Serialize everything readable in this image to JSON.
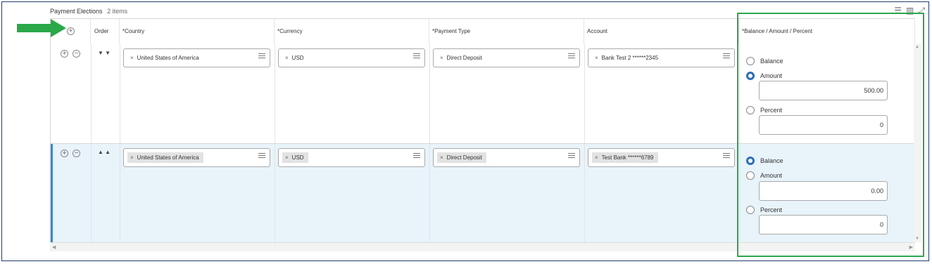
{
  "section": {
    "title": "Payment Elections",
    "count": "2 items"
  },
  "columns": {
    "order": "Order",
    "country": "*Country",
    "currency": "*Currency",
    "payment_type": "*Payment Type",
    "account": "Account",
    "balance": "*Balance / Amount / Percent"
  },
  "rows": [
    {
      "order_arrows": "▼ ▼",
      "country": "United States of America",
      "currency": "USD",
      "payment_type": "Direct Deposit",
      "account": "Bank Test 2 ******2345",
      "options": {
        "balance": "Balance",
        "amount": "Amount",
        "percent": "Percent"
      },
      "selected": "amount",
      "amount_value": "500.00",
      "percent_value": "0"
    },
    {
      "order_arrows": "▲ ▲",
      "country": "United States of America",
      "currency": "USD",
      "payment_type": "Direct Deposit",
      "account": "Test Bank ******6789",
      "options": {
        "balance": "Balance",
        "amount": "Amount",
        "percent": "Percent"
      },
      "selected": "balance",
      "amount_value": "0.00",
      "percent_value": "0"
    }
  ],
  "icons": {
    "add": "plus-circle-icon",
    "remove": "minus-circle-icon",
    "remove_chip": "x-icon",
    "prompt": "list-icon",
    "filter": "filter-icon",
    "columns": "columns-icon",
    "expand": "expand-icon"
  },
  "colors": {
    "highlight": "#2aa84a",
    "arrow": "#2aa84a",
    "selected_row": "#e8f3fa",
    "radio_selected": "#2a6ebb"
  }
}
